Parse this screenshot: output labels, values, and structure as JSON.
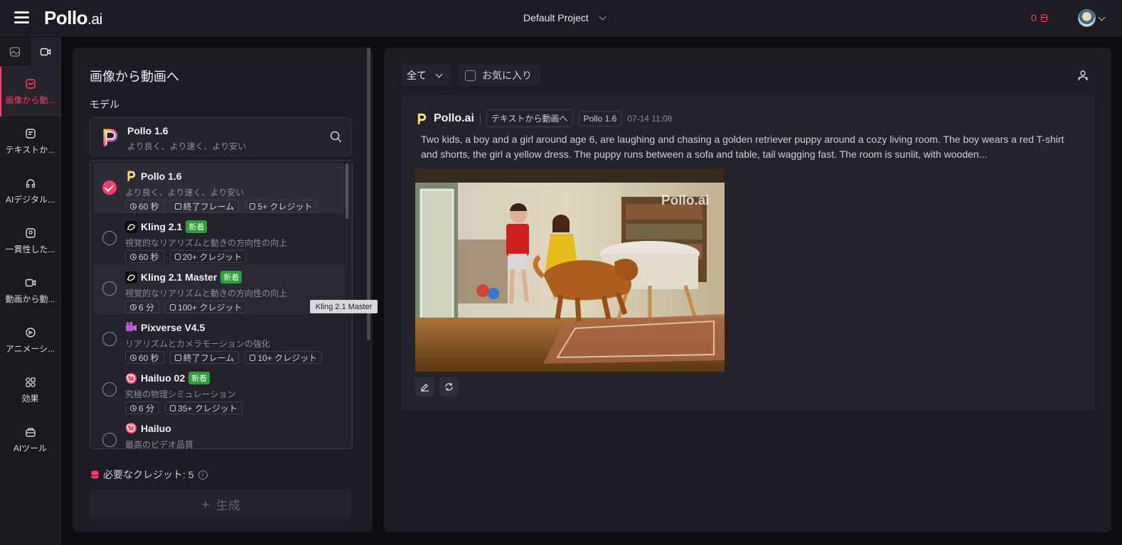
{
  "header": {
    "logo_main": "Pollo",
    "logo_suffix": ".ai",
    "project": "Default Project",
    "credits": "0"
  },
  "sidebar": {
    "items": [
      {
        "label": "画像から動..."
      },
      {
        "label": "テキストか..."
      },
      {
        "label": "AIデジタル..."
      },
      {
        "label": "一貫性した..."
      },
      {
        "label": "動画から動..."
      },
      {
        "label": "アニメーシ..."
      },
      {
        "label": "効果"
      },
      {
        "label": "AIツール"
      }
    ]
  },
  "panel": {
    "title": "画像から動画へ",
    "model_label": "モデル",
    "selected_model": {
      "name": "Pollo 1.6",
      "desc": "より良く、より速く、より安い"
    },
    "models": [
      {
        "name": "Pollo 1.6",
        "desc": "より良く、より速く、より安い",
        "badge": "",
        "tags": [
          "60 秒",
          "終了フレーム",
          "5+ クレジット"
        ],
        "icon_color": "#f2f0f6"
      },
      {
        "name": "Kling 2.1",
        "desc": "視覚的なリアリズムと動きの方向性の向上",
        "badge": "新着",
        "tags": [
          "60 秒",
          "20+ クレジット"
        ],
        "icon_color": "#111111"
      },
      {
        "name": "Kling 2.1 Master",
        "desc": "視覚的なリアリズムと動きの方向性の向上",
        "badge": "新着",
        "tags": [
          "6 分",
          "100+ クレジット"
        ],
        "icon_color": "#111111"
      },
      {
        "name": "Pixverse V4.5",
        "desc": "リアリズムとカメラモーションの強化",
        "badge": "",
        "tags": [
          "60 秒",
          "終了フレーム",
          "10+ クレジット"
        ],
        "icon_color": "#b45ae0"
      },
      {
        "name": "Hailuo 02",
        "desc": "究極の物理シミュレーション",
        "badge": "新着",
        "tags": [
          "6 分",
          "35+ クレジット"
        ],
        "icon_color": "#ff5a5a"
      },
      {
        "name": "Hailuo",
        "desc": "最高のビデオ品質",
        "badge": "",
        "tags": [],
        "icon_color": "#ff5a5a"
      }
    ],
    "tooltip": "Kling 2.1 Master",
    "credits_label": "必要なクレジット: 5",
    "generate": "生成"
  },
  "feed": {
    "filter": "全て",
    "favorites": "お気に入り",
    "card": {
      "brand": "Pollo.ai",
      "mode": "テキストから動画へ",
      "model": "Pollo 1.6",
      "time": "07-14 11:08",
      "prompt": "Two kids, a boy and a girl around age 6, are laughing and chasing a golden retriever puppy around a cozy living room. The boy wears a red T-shirt and shorts, the girl a yellow dress. The puppy runs between a sofa and table, tail wagging fast. The room is sunlit, with wooden...",
      "watermark": "Pollo.ai"
    }
  },
  "colors": {
    "accent": "#ff3d6c",
    "new_badge": "#2e9e3c"
  }
}
